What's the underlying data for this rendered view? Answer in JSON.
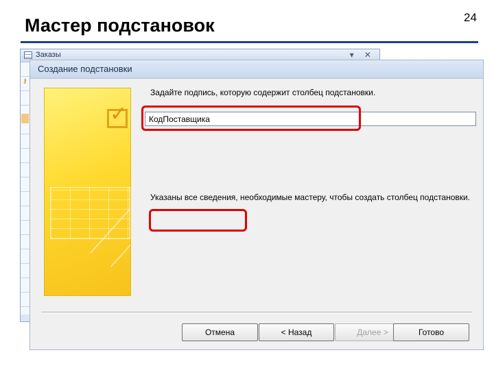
{
  "slide": {
    "title": "Мастер подстановок",
    "page_number": "24"
  },
  "background_window": {
    "title": "Заказы",
    "controls": "▾ ✕"
  },
  "dialog": {
    "title": "Создание подстановки",
    "prompt": "Задайте подпись, которую содержит столбец подстановки.",
    "input_value": "КодПоставщика",
    "info_text": "Указаны все сведения, необходимые мастеру, чтобы создать столбец подстановки.",
    "buttons": {
      "cancel": "Отмена",
      "back": "< Назад",
      "next": "Далее >",
      "finish": "Готово"
    }
  },
  "colors": {
    "highlight": "#e00000",
    "title_rule": "#1f3f8f",
    "wizard_image": "#ffd92e"
  }
}
